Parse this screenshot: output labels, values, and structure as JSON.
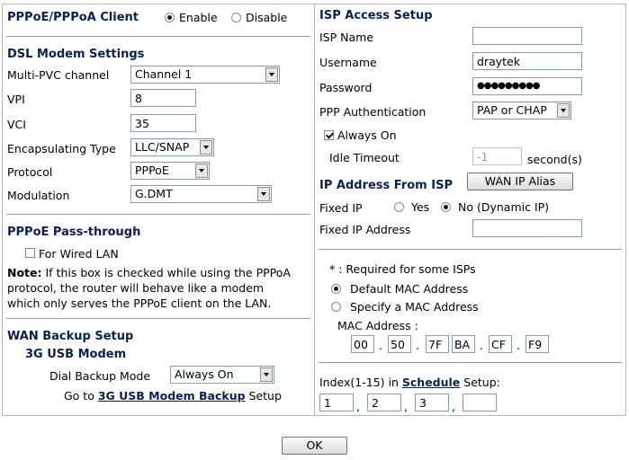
{
  "pppoe_client": {
    "title": "PPPoE/PPPoA Client",
    "enable_label": "Enable",
    "disable_label": "Disable",
    "selected": "enable"
  },
  "dsl": {
    "title": "DSL Modem Settings",
    "multi_pvc_label": "Multi-PVC channel",
    "multi_pvc_value": "Channel 1",
    "vpi_label": "VPI",
    "vpi_value": "8",
    "vci_label": "VCI",
    "vci_value": "35",
    "encap_label": "Encapsulating Type",
    "encap_value": "LLC/SNAP",
    "protocol_label": "Protocol",
    "protocol_value": "PPPoE",
    "modulation_label": "Modulation",
    "modulation_value": "G.DMT"
  },
  "passthrough": {
    "title": "PPPoE Pass-through",
    "wired_lan_label": "For Wired LAN",
    "wired_lan_checked": false,
    "note_bold": "Note:",
    "note_line1": " If this box is checked while using the PPPoA",
    "note_line2": "protocol, the router will behave like a modem",
    "note_line3": "which only serves the PPPoE client on the LAN."
  },
  "wan_backup": {
    "title": "WAN Backup Setup",
    "modem_title": "3G USB Modem",
    "dial_label": "Dial Backup Mode",
    "dial_value": "Always On",
    "goto_prefix": "Go to ",
    "goto_link": "3G USB Modem Backup",
    "goto_suffix": " Setup"
  },
  "isp": {
    "title": "ISP Access Setup",
    "isp_name_label": "ISP Name",
    "isp_name_value": "",
    "username_label": "Username",
    "username_value": "draytek",
    "password_label": "Password",
    "password_value": "●●●●●●●●●",
    "ppp_auth_label": "PPP Authentication",
    "ppp_auth_value": "PAP or CHAP",
    "always_on_label": "Always On",
    "always_on_checked": true,
    "idle_label": "Idle Timeout",
    "idle_value": "-1",
    "idle_unit": "second(s)"
  },
  "ip_address": {
    "title": "IP Address From ISP",
    "alias_button": "WAN IP Alias",
    "fixed_ip_label": "Fixed IP",
    "yes_label": "Yes",
    "no_label": "No (Dynamic IP)",
    "selected": "no",
    "fixed_ip_address_label": "Fixed IP Address",
    "fixed_ip_address_value": ""
  },
  "mac": {
    "note": "* : Required for some ISPs",
    "default_label": "Default MAC Address",
    "specify_label": "Specify a MAC Address",
    "selected": "default",
    "address_label": "MAC Address :",
    "octets": [
      "00",
      "50",
      "7F",
      "BA",
      "CF",
      "F9"
    ],
    "octet_sep": "."
  },
  "schedule": {
    "prefix": "Index(1-15) in ",
    "link": "Schedule",
    "suffix": " Setup:",
    "values": [
      "1",
      "2",
      "3",
      ""
    ],
    "sep": ","
  },
  "ok_button": "OK"
}
